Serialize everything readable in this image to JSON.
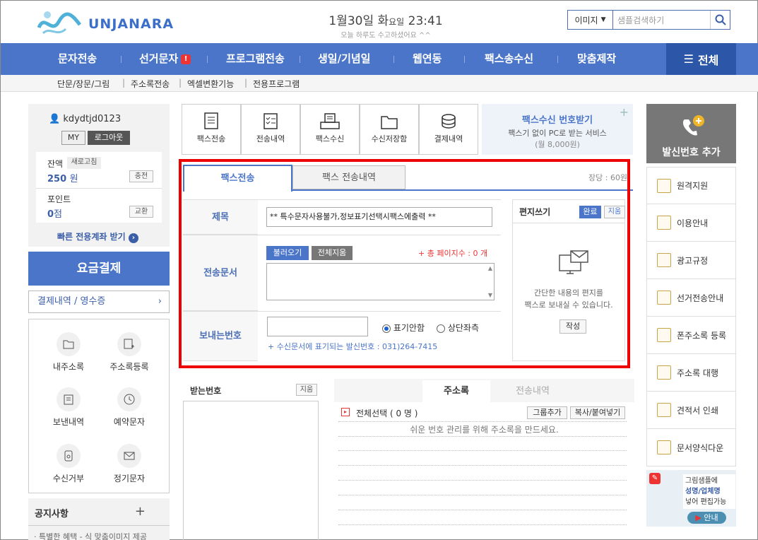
{
  "header": {
    "brand": "UNJANARA",
    "date_prefix": "1월30일 화",
    "weekday_suffix": "요일",
    "time": "23:41",
    "greeting": "오늘 하루도 수고하셨어요 ^^",
    "search_type": "이미지",
    "search_placeholder": "샘플검색하기"
  },
  "nav": {
    "items": [
      "문자전송",
      "선거문자",
      "프로그램전송",
      "생일/기념일",
      "웹연동",
      "팩스송수신",
      "맞춤제작"
    ],
    "election_badge": "!",
    "all_label": "전체",
    "sub_items": [
      "단문/장문/그림",
      "주소록전송",
      "엑셀변환기능",
      "전용프로그램"
    ]
  },
  "user": {
    "id": "kdydtjd0123",
    "my_label": "MY",
    "logout_label": "로그아웃",
    "balance_label": "잔액",
    "refresh_label": "새로고침",
    "balance_value": "250",
    "balance_unit": "원",
    "charge_label": "충전",
    "point_label": "포인트",
    "point_value": "0",
    "point_unit": "점",
    "exchange_label": "교환",
    "fast_account": "빠른 전용계좌 받기"
  },
  "payment": {
    "pay_label": "요금결제",
    "receipt_label": "결제내역 / 영수증"
  },
  "quick_menu": [
    "내주소록",
    "주소록등록",
    "보낸내역",
    "예약문자",
    "수신거부",
    "정기문자"
  ],
  "notice": {
    "title": "공지사항",
    "item": "· 특별한 혜택 - 식 맞춤이미지 제공"
  },
  "fax_tiles": [
    "팩스전송",
    "전송내역",
    "팩스수신",
    "수신저장함",
    "결제내역"
  ],
  "fax_receive": {
    "title": "팩스수신 번호받기",
    "desc": "팩스기 없이 PC로 받는 서비스",
    "price": "(월 8,000원)"
  },
  "fax_form": {
    "tab_send": "팩스전송",
    "tab_history": "팩스 전송내역",
    "unit_price": "장당 : 60원",
    "title_label": "제목",
    "title_value": "** 특수문자사용불가,정보표기선택시팩스에출력 **",
    "doc_label": "전송문서",
    "load_label": "불러오기",
    "clear_all_label": "전체지움",
    "page_count": "+ 총 페이지수 : 0 개",
    "sender_label": "보내는번호",
    "radio_hide": "표기안함",
    "radio_top_left": "상단좌측",
    "sender_note": "+ 수신문서에 표기되는 발신번호 : 031)264-7415"
  },
  "letter": {
    "title": "편지쓰기",
    "done_label": "완료",
    "clear_label": "지움",
    "desc1": "간단한 내용의 편지를",
    "desc2": "팩스로 보내실 수 있습니다.",
    "write_label": "작성"
  },
  "recipients": {
    "title": "받는번호",
    "clear_label": "지움"
  },
  "addressbook": {
    "tab_addr": "주소록",
    "tab_history": "전송내역",
    "select_all": "전체선택 ( 0 명 )",
    "group_add": "그룹추가",
    "copy_paste": "복사/붙여넣기",
    "empty_msg": "쉬운 번호 관리를 위해 주소록을 만드세요."
  },
  "right_panel": {
    "add_caller": "발신번호 추가",
    "links": [
      "원격지원",
      "이용안내",
      "광고규정",
      "선거전송안내",
      "폰주소록 등록",
      "주소록 대행",
      "견적서 인쇄",
      "문서양식다운"
    ],
    "promo_line1": "그림샘플에",
    "promo_line2": "성명/업체명",
    "promo_line3": "넣어 편집가능",
    "promo_btn": "안내"
  }
}
